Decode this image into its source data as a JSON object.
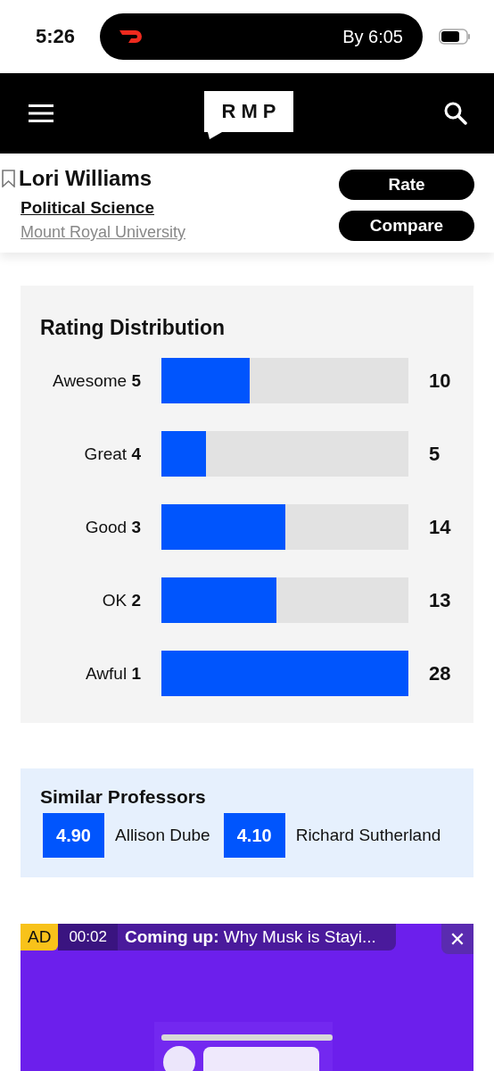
{
  "status_bar": {
    "time": "5:26",
    "live_activity": {
      "eta": "By 6:05"
    }
  },
  "header": {
    "logo": "RMP"
  },
  "professor": {
    "name": "Lori Williams",
    "saved": false,
    "department": "Political Science",
    "school": "Mount Royal University"
  },
  "actions": [
    "Rate",
    "Compare"
  ],
  "rating_distribution": {
    "title": "Rating Distribution",
    "rows": [
      {
        "label": "Awesome **5**",
        "level": 0.357,
        "count": "10"
      },
      {
        "label": "Great **4**",
        "level": 0.179,
        "count": "5"
      },
      {
        "label": "Good **3**",
        "level": 0.5,
        "count": "14"
      },
      {
        "label": "OK **2**",
        "level": 0.464,
        "count": "13"
      },
      {
        "label": "Awful **1**",
        "level": 1,
        "count": "28"
      }
    ]
  },
  "similar_professors": {
    "title": "Similar Professors",
    "items": [
      {
        "rating": "4.90",
        "name": "Allison Dube"
      },
      {
        "rating": "4.10",
        "name": "Richard Sutherland"
      }
    ]
  },
  "ad": {
    "badge": "AD",
    "timer": "00:02",
    "coming_up_label": "Coming up:",
    "coming_up_title": "Why Musk is Stayi...",
    "close": "✕"
  }
}
